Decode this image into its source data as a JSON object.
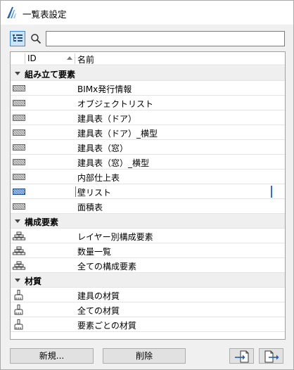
{
  "window": {
    "title": "一覧表設定",
    "icon": "archicad-logo-icon"
  },
  "toolbar": {
    "tree_view_icon": "tree-view-icon",
    "search_icon": "search-icon",
    "search_value": "",
    "search_placeholder": ""
  },
  "list": {
    "columns": {
      "id": "ID",
      "name": "名前",
      "sort": "ascending"
    },
    "selected_item": "壁リスト",
    "groups": [
      {
        "label": "組み立て要素",
        "expanded": true,
        "item_icon": "hatch-pattern-icon",
        "items": [
          "BIMx発行情報",
          "オブジェクトリスト",
          "建具表（ドア）",
          "建具表（ドア）_横型",
          "建具表（窓）",
          "建具表（窓）_横型",
          "内部仕上表",
          "壁リスト",
          "面積表"
        ]
      },
      {
        "label": "構成要素",
        "expanded": true,
        "item_icon": "component-stack-icon",
        "items": [
          "レイヤー別構成要素",
          "数量一覧",
          "全ての構成要素"
        ]
      },
      {
        "label": "材質",
        "expanded": true,
        "item_icon": "paint-brush-icon",
        "items": [
          "建具の材質",
          "全ての材質",
          "要素ごとの材質"
        ]
      }
    ]
  },
  "footer": {
    "new_label": "新規...",
    "delete_label": "削除",
    "import_icon": "import-icon",
    "export_icon": "export-icon"
  },
  "colors": {
    "selection_accent": "#2f6fd0",
    "group_background": "#efefef"
  }
}
